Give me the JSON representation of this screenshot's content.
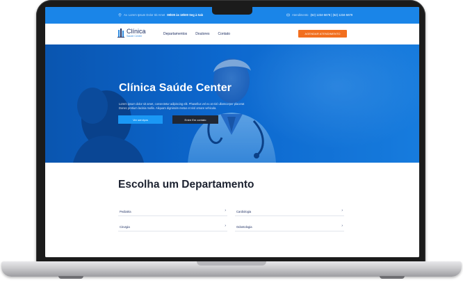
{
  "topbar": {
    "address_prefix": "Av. Lorem Ipsum Dolor Sit Amet",
    "hours": "08h00 às 18h00 Seg à Sab",
    "contact_prefix": "Atendimento",
    "phones": "(62) 1234-5678 | (62) 1234-5679"
  },
  "nav": {
    "logo_name": "Clínica",
    "logo_sub": "Saúde Center",
    "menu": [
      "Departamentos",
      "Doutores",
      "Contato"
    ],
    "cta": "AGENDAR ATENDIMENTO"
  },
  "hero": {
    "title": "Clínica Saúde Center",
    "lorem_1": "Lorem ipsum dolor sit amet, consectetur adipiscing elit. Phasellus vel ex at nisl ullamcorper placerat",
    "lorem_2": "Donec pretium lacinia mollis. Aliquam dignissim metus et nisl ornare vehicula.",
    "primary_button": "Ver serviços",
    "secondary_button": "Entre Em contato"
  },
  "departments": {
    "title": "Escolha um Departamento",
    "items": [
      "Pediatria",
      "Cardiologia",
      "Cirurgia",
      "Odontologia"
    ]
  },
  "colors": {
    "topbar": "#1a85e8",
    "hero_start": "#0a57b2",
    "hero_end": "#1a86ea",
    "cta": "#f26f1f",
    "primary_button": "#1a98f5",
    "dark_button": "#202734",
    "navy_text": "#1e2f63"
  },
  "icons": {
    "address": "map-pin-icon",
    "contact": "phone-icon",
    "logo": "clinic-logo-icon",
    "arrow": "chevron-right-icon"
  }
}
